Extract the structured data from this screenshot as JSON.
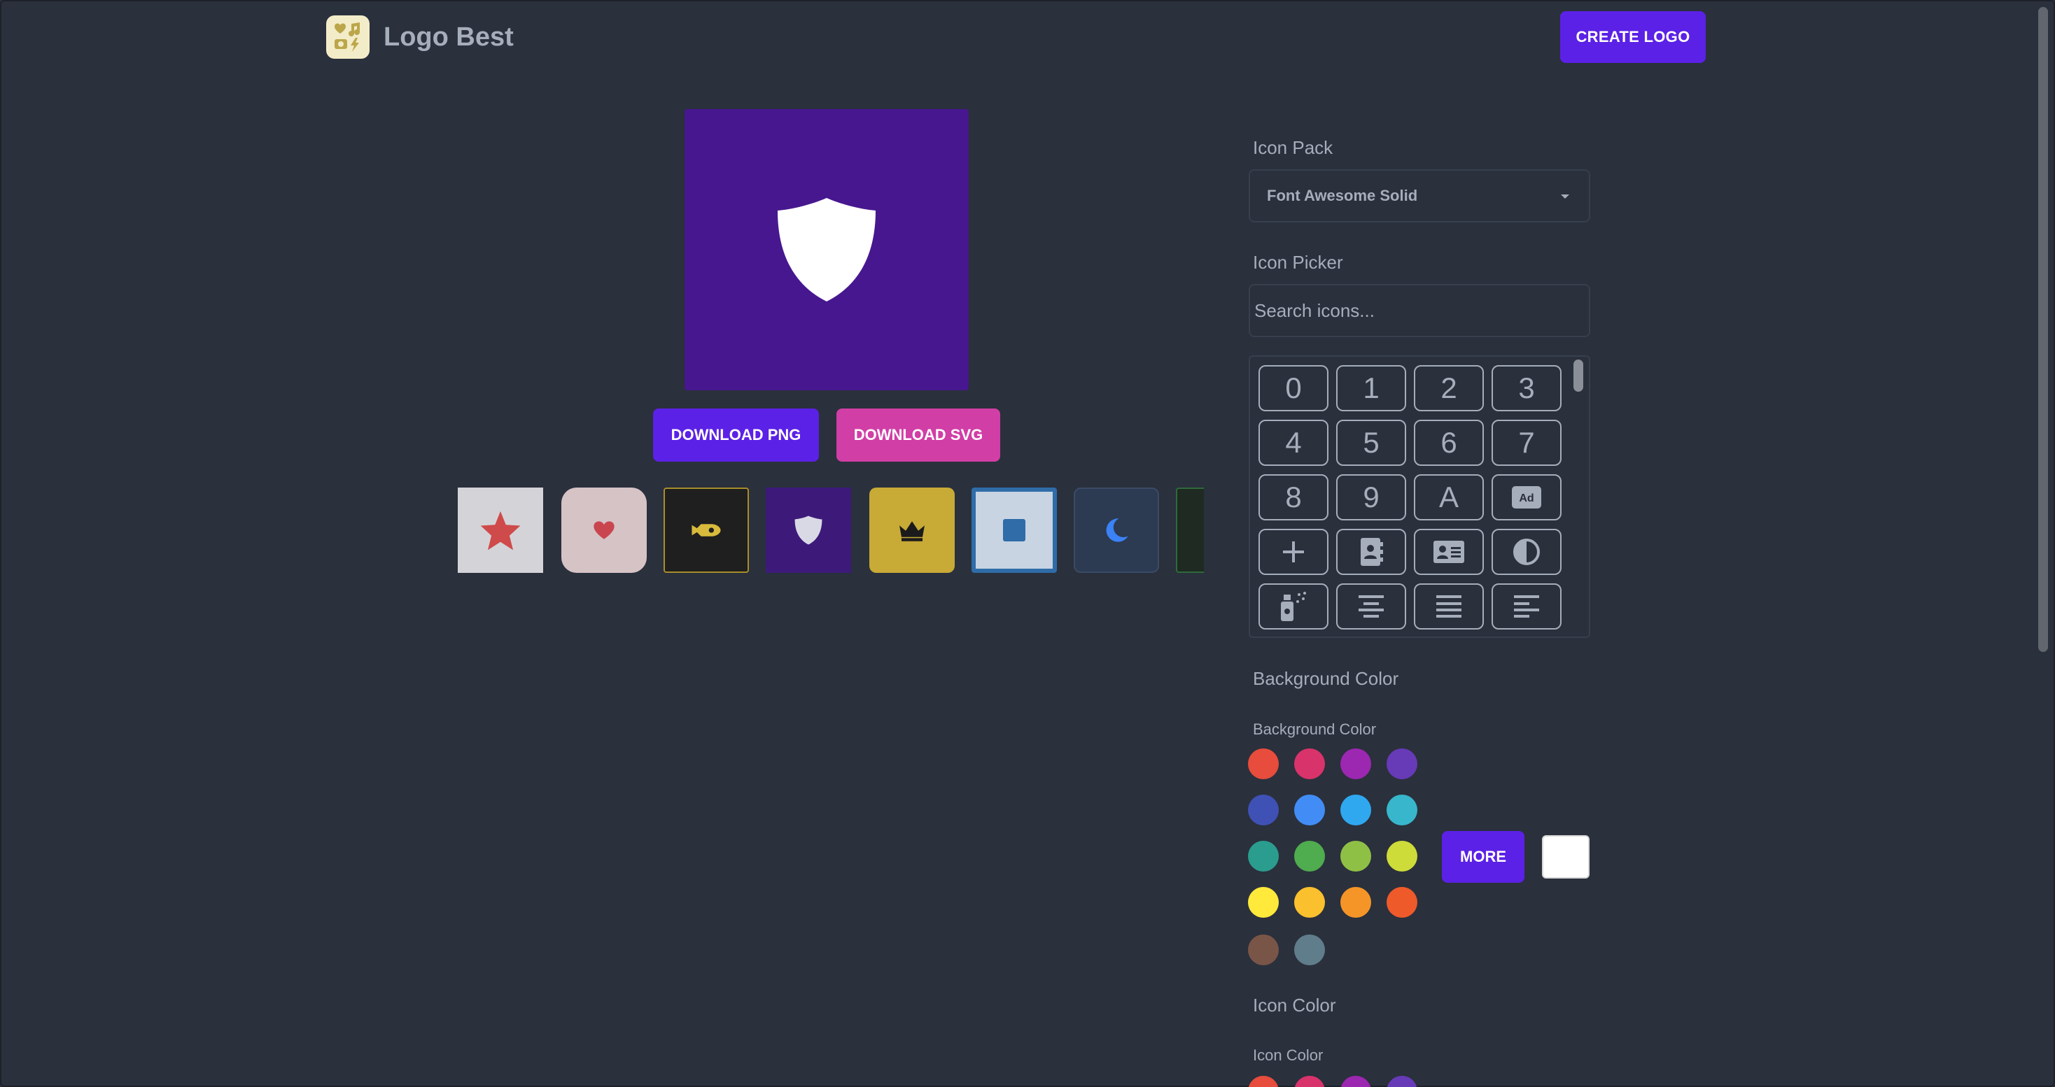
{
  "header": {
    "brand_name": "Logo Best",
    "create_label": "CREATE LOGO"
  },
  "preview": {
    "background_color": "#47178f",
    "icon": "shield-icon",
    "icon_color": "#ffffff"
  },
  "actions": {
    "download_png_label": "DOWNLOAD PNG",
    "download_svg_label": "DOWNLOAD SVG"
  },
  "presets": [
    {
      "icon": "star-icon",
      "bg": "#d4d4d8",
      "fg": "#cf4a4a"
    },
    {
      "icon": "heart-icon",
      "bg": "#d6c3c6",
      "fg": "#c9464f"
    },
    {
      "icon": "rocket-icon",
      "bg": "#1f1f1f",
      "fg": "#d8bb3c"
    },
    {
      "icon": "shield-icon",
      "bg": "#3d1a7a",
      "fg": "#d9d9e6"
    },
    {
      "icon": "crown-icon",
      "bg": "#c8aa36",
      "fg": "#1b1b1b"
    },
    {
      "icon": "square-icon",
      "bg": "#c8d4e2",
      "fg": "#2f6ca8"
    },
    {
      "icon": "moon-icon",
      "bg": "#2c3a52",
      "fg": "#3b82f6"
    },
    {
      "icon": "partial-icon",
      "bg": "#1e2a22",
      "fg": "#2f6a3a"
    }
  ],
  "panel": {
    "icon_pack_label": "Icon Pack",
    "icon_pack_value": "Font Awesome Solid",
    "icon_picker_label": "Icon Picker",
    "search_placeholder": "Search icons...",
    "icons": [
      "0",
      "1",
      "2",
      "3",
      "4",
      "5",
      "6",
      "7",
      "8",
      "9",
      "A",
      "ad-icon",
      "plus-icon",
      "address-book-icon",
      "address-card-icon",
      "adjust-icon",
      "air-freshener-icon",
      "align-center-icon",
      "align-justify-icon",
      "align-left-icon"
    ],
    "bg_color_heading": "Background Color",
    "bg_color_sublabel": "Background Color",
    "more_label": "MORE",
    "selected_bg_color": "#ffffff",
    "colors": [
      "#e74c3c",
      "#d9336b",
      "#9c27b0",
      "#673ab7",
      "#3f51b5",
      "#428df5",
      "#2fa8f0",
      "#38b6cc",
      "#2a9d8f",
      "#4fac4f",
      "#8fc046",
      "#cddc39",
      "#ffe93b",
      "#fbc02d",
      "#f59527",
      "#ee5a2a",
      "#795548",
      "#607d8b"
    ],
    "icon_color_heading": "Icon Color",
    "icon_color_sublabel": "Icon Color",
    "icon_colors_visible": [
      "#e74c3c",
      "#d9336b",
      "#9c27b0",
      "#673ab7"
    ]
  }
}
